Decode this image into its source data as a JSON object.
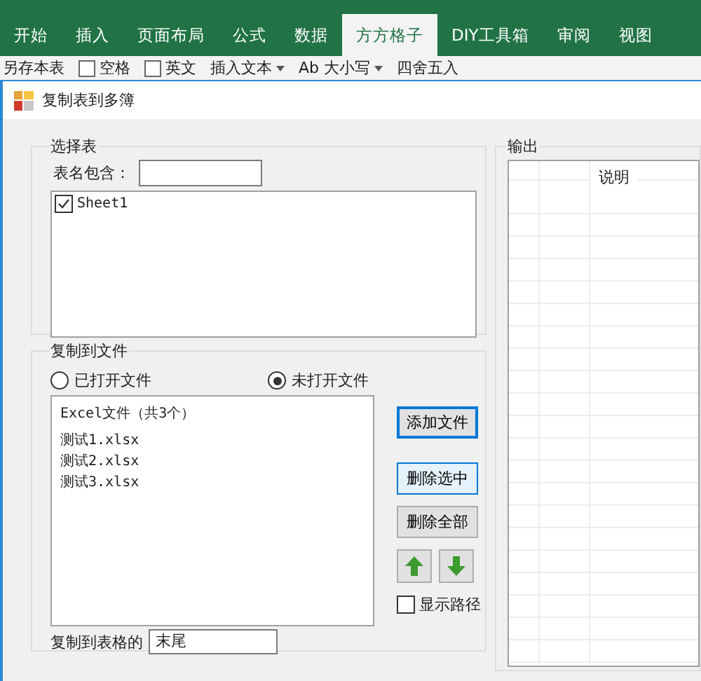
{
  "ribbon": {
    "tabs": [
      {
        "label": "开始",
        "selected": false
      },
      {
        "label": "插入",
        "selected": false
      },
      {
        "label": "页面布局",
        "selected": false
      },
      {
        "label": "公式",
        "selected": false
      },
      {
        "label": "数据",
        "selected": false
      },
      {
        "label": "方方格子",
        "selected": true
      },
      {
        "label": "DIY工具箱",
        "selected": false
      },
      {
        "label": "审阅",
        "selected": false
      },
      {
        "label": "视图",
        "selected": false
      }
    ]
  },
  "toolbar": [
    {
      "kind": "button",
      "label": "另存本表"
    },
    {
      "kind": "checkbox",
      "label": "空格",
      "checked": false
    },
    {
      "kind": "checkbox",
      "label": "英文",
      "checked": false
    },
    {
      "kind": "dropdown",
      "label": "插入文本"
    },
    {
      "kind": "dropdown",
      "label": "Ab 大小写"
    },
    {
      "kind": "button",
      "label": "四舍五入"
    }
  ],
  "dialog": {
    "title": "复制表到多簿",
    "select_sheets": {
      "title": "选择表",
      "filter_label": "表名包含：",
      "sheets": [
        {
          "name": "Sheet1",
          "checked": true
        }
      ]
    },
    "copy_to_files": {
      "title": "复制到文件",
      "sources": [
        {
          "label": "已打开文件",
          "selected": false
        },
        {
          "label": "未打开文件",
          "selected": true
        }
      ],
      "list_header": "Excel文件（共3个）",
      "files": [
        "测试1.xlsx",
        "测试2.xlsx",
        "测试3.xlsx"
      ],
      "buttons": [
        {
          "label": "添加文件",
          "default": true,
          "hot": false
        },
        {
          "label": "删除选中",
          "default": false,
          "hot": true
        },
        {
          "label": "删除全部",
          "default": false,
          "hot": false
        }
      ],
      "show_path": {
        "label": "显示路径",
        "checked": false
      },
      "position_label": "复制到表格的",
      "position_value": "末尾"
    },
    "output": {
      "title": "输出",
      "columns": [
        "说明"
      ]
    }
  }
}
